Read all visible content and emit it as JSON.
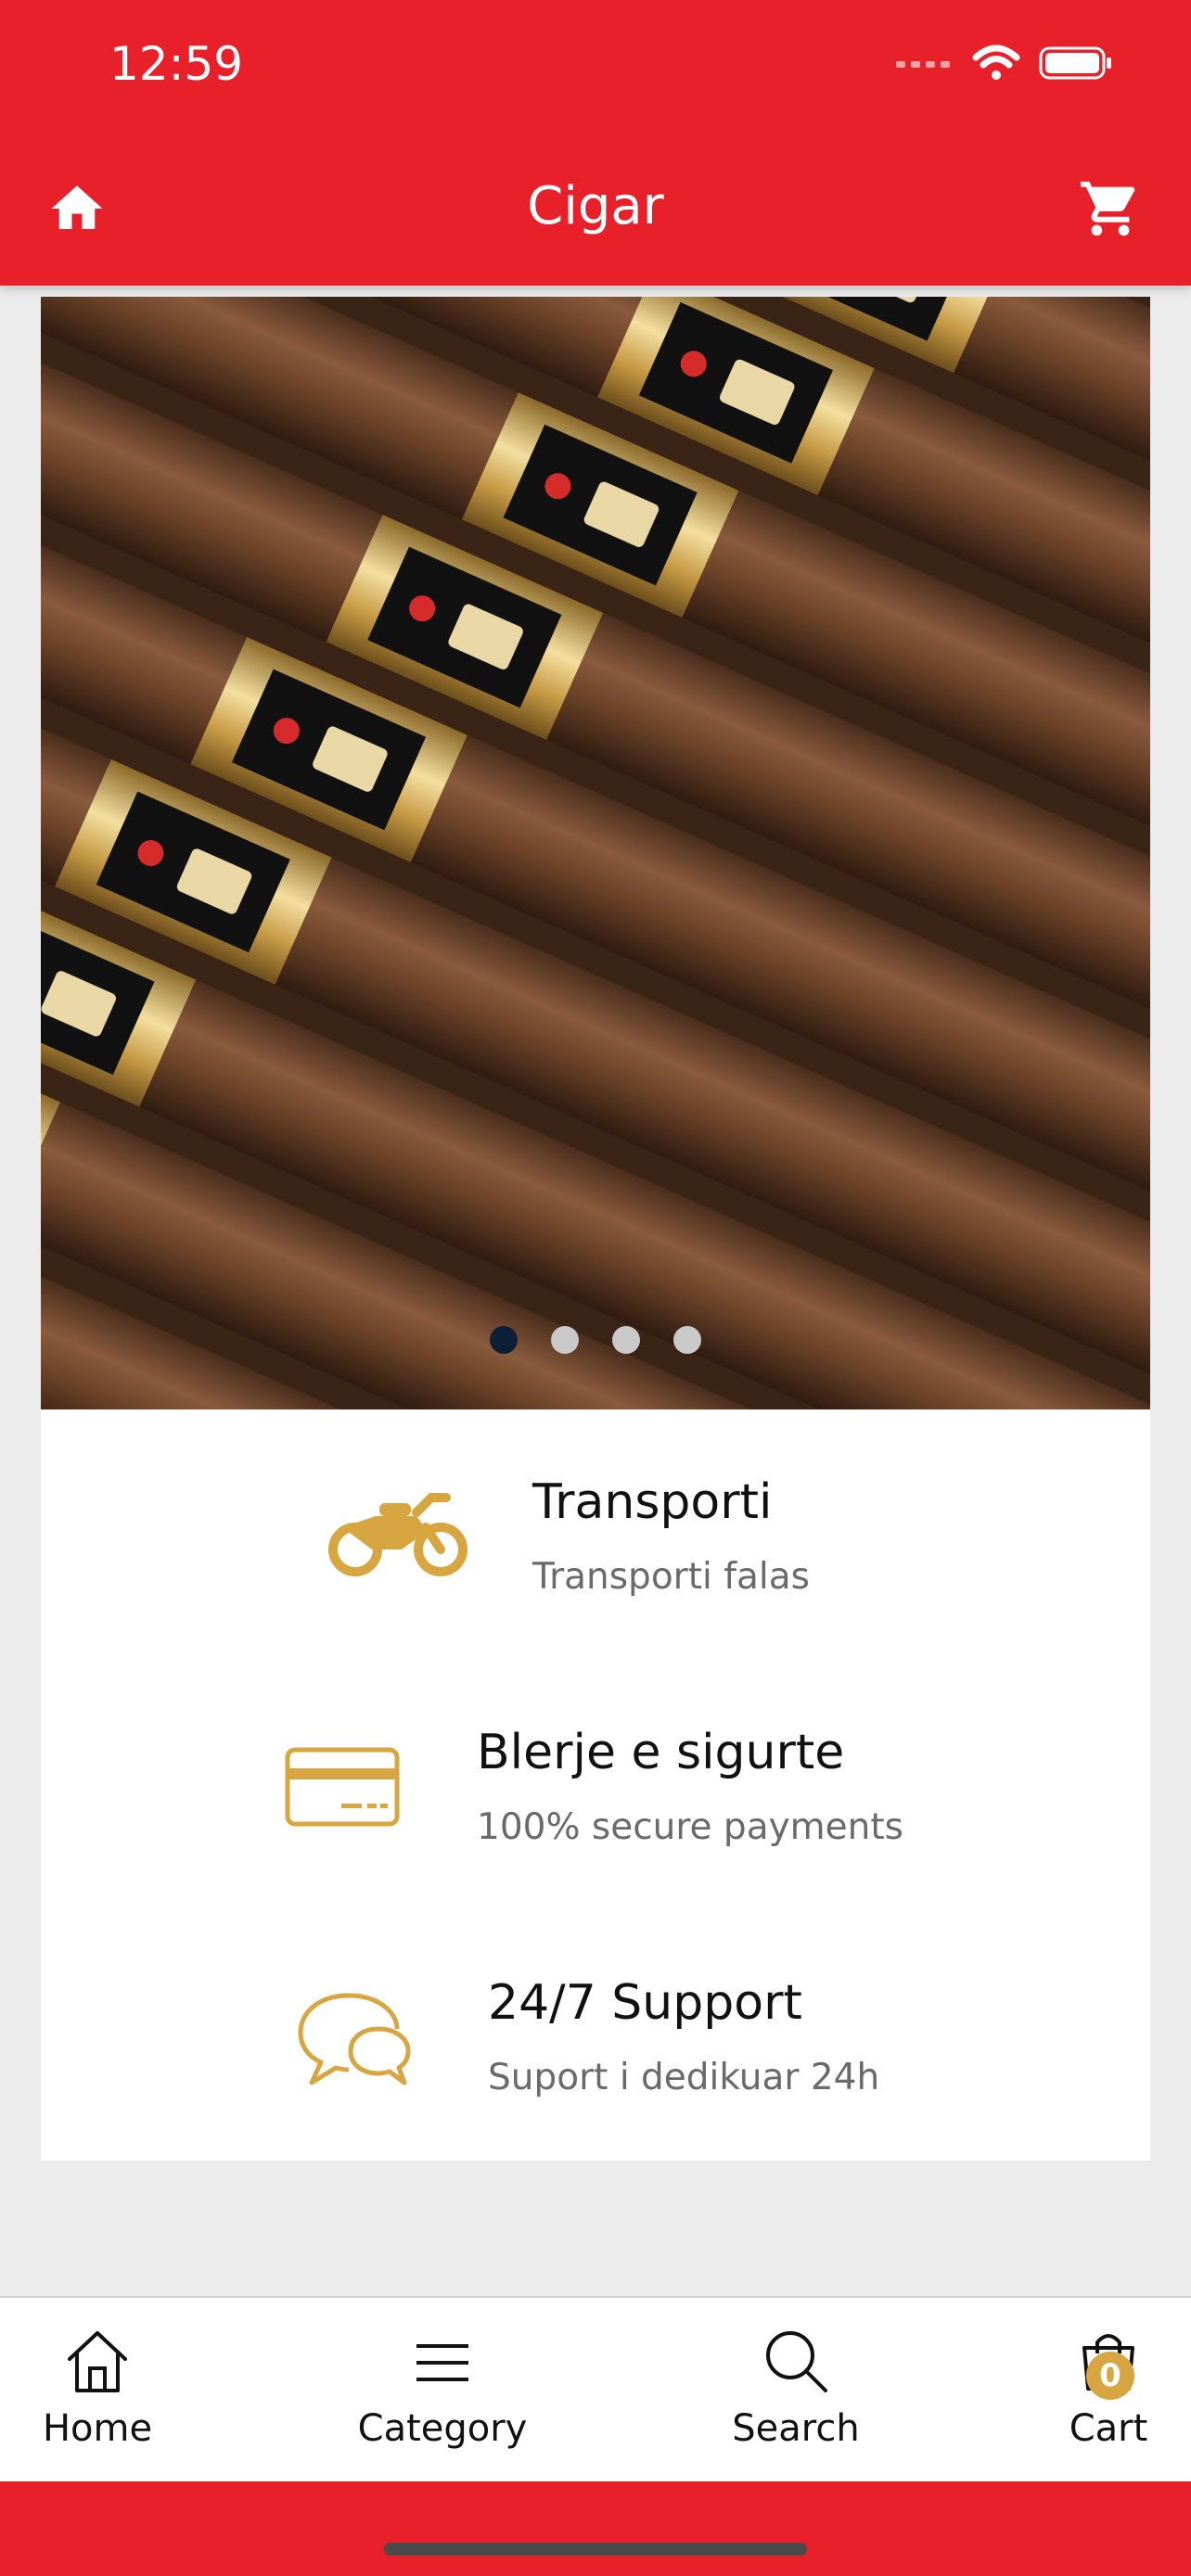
{
  "status_bar": {
    "time": "12:59"
  },
  "header": {
    "title": "Cigar",
    "home_icon": "home-icon",
    "cart_icon": "cart-icon"
  },
  "banner": {
    "slide_count": 4,
    "active_index": 0
  },
  "features": [
    {
      "icon": "motorcycle-icon",
      "title": "Transporti",
      "subtitle": "Transporti falas"
    },
    {
      "icon": "credit-card-icon",
      "title": "Blerje e sigurte",
      "subtitle": "100% secure payments"
    },
    {
      "icon": "chat-bubbles-icon",
      "title": "24/7 Support",
      "subtitle": "Suport i dedikuar 24h"
    }
  ],
  "tabbar": {
    "items": [
      {
        "label": "Home",
        "icon": "home-outline-icon"
      },
      {
        "label": "Category",
        "icon": "menu-icon"
      },
      {
        "label": "Search",
        "icon": "search-icon"
      },
      {
        "label": "Cart",
        "icon": "shopping-bag-icon",
        "badge": "0"
      }
    ]
  },
  "colors": {
    "brand": "#e8202a",
    "accent": "#d8a640",
    "dot_active": "#0e2035",
    "dot_inactive": "#c9c9c9"
  }
}
